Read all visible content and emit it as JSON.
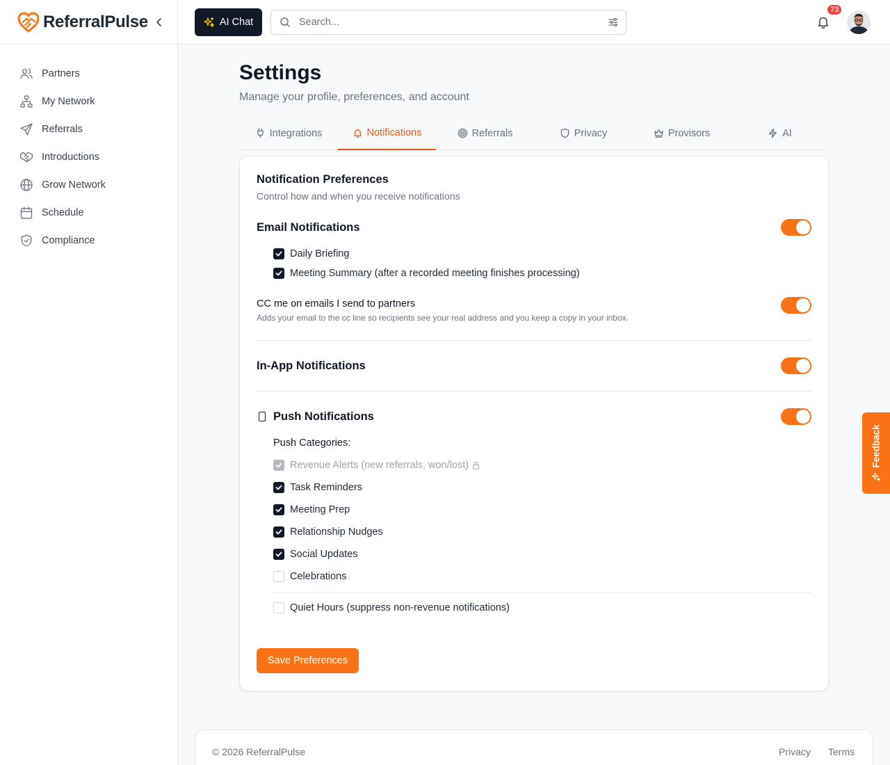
{
  "brand": {
    "name": "ReferralPulse"
  },
  "sidebar": {
    "items": [
      {
        "label": "Partners",
        "icon": "users-icon"
      },
      {
        "label": "My Network",
        "icon": "network-icon"
      },
      {
        "label": "Referrals",
        "icon": "send-icon"
      },
      {
        "label": "Introductions",
        "icon": "handshake-icon"
      },
      {
        "label": "Grow Network",
        "icon": "globe-icon"
      },
      {
        "label": "Schedule",
        "icon": "calendar-icon"
      },
      {
        "label": "Compliance",
        "icon": "shield-check-icon"
      }
    ]
  },
  "header": {
    "ai_chat_label": "AI Chat",
    "search_placeholder": "Search...",
    "notification_count": "73"
  },
  "page": {
    "title": "Settings",
    "subtitle": "Manage your profile, preferences, and account"
  },
  "tabs": [
    {
      "label": "Integrations",
      "icon": "plug-icon"
    },
    {
      "label": "Notifications",
      "icon": "bell-icon",
      "active": true
    },
    {
      "label": "Referrals",
      "icon": "target-icon"
    },
    {
      "label": "Privacy",
      "icon": "shield-icon"
    },
    {
      "label": "Provisors",
      "icon": "crown-icon"
    },
    {
      "label": "AI",
      "icon": "zap-icon"
    }
  ],
  "card": {
    "title": "Notification Preferences",
    "subtitle": "Control how and when you receive notifications",
    "email": {
      "title": "Email Notifications",
      "enabled": true,
      "options": [
        {
          "label": "Daily Briefing",
          "checked": true
        },
        {
          "label": "Meeting Summary (after a recorded meeting finishes processing)",
          "checked": true
        }
      ]
    },
    "cc": {
      "title": "CC me on emails I send to partners",
      "description": "Adds your email to the cc line so recipients see your real address and you keep a copy in your inbox.",
      "enabled": true
    },
    "in_app": {
      "title": "In-App Notifications",
      "enabled": true
    },
    "push": {
      "title": "Push Notifications",
      "enabled": true,
      "categories_label": "Push Categories:",
      "categories": [
        {
          "label": "Revenue Alerts (new referrals, won/lost)",
          "checked": true,
          "disabled": true
        },
        {
          "label": "Task Reminders",
          "checked": true
        },
        {
          "label": "Meeting Prep",
          "checked": true
        },
        {
          "label": "Relationship Nudges",
          "checked": true
        },
        {
          "label": "Social Updates",
          "checked": true
        },
        {
          "label": "Celebrations",
          "checked": false
        }
      ],
      "quiet_hours": {
        "label": "Quiet Hours (suppress non-revenue notifications)",
        "checked": false
      }
    },
    "save_label": "Save Preferences"
  },
  "feedback_label": "Feedback",
  "footer": {
    "copyright": "© 2026 ReferralPulse",
    "links": [
      "Privacy",
      "Terms"
    ]
  },
  "colors": {
    "accent": "#f97316",
    "accent_text": "#ea580c",
    "dark": "#111827",
    "badge": "#ef4444"
  }
}
